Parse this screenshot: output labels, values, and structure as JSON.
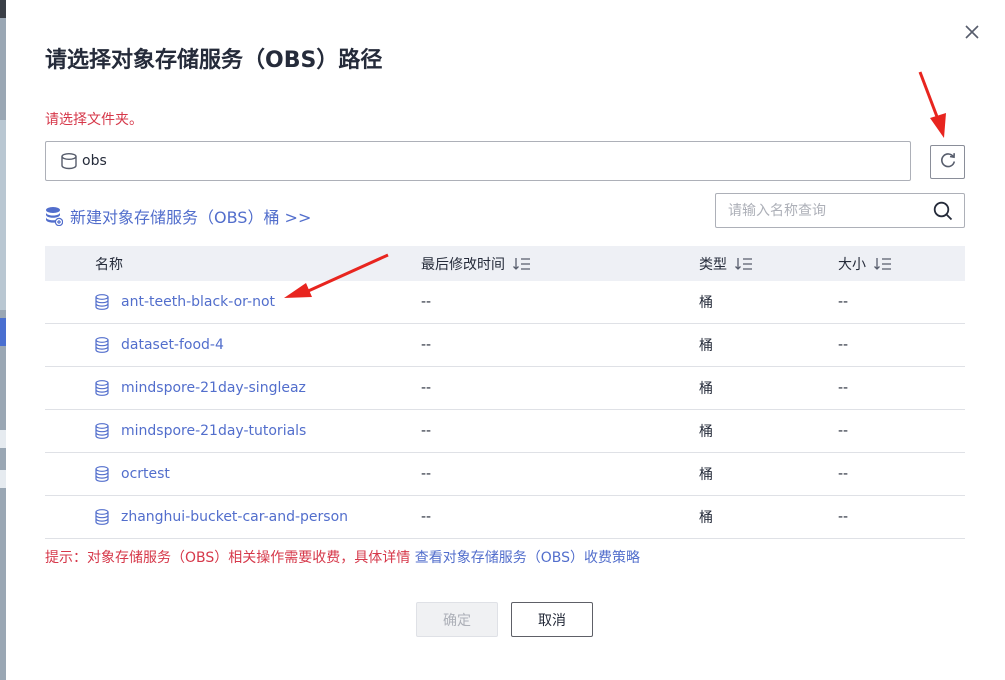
{
  "dialog": {
    "title": "请选择对象存储服务（OBS）路径",
    "folder_hint": "请选择文件夹。",
    "path_value": "obs",
    "create_bucket_link": "新建对象存储服务（OBS）桶 >>",
    "search_placeholder": "请输入名称查询"
  },
  "table": {
    "columns": [
      "名称",
      "最后修改时间",
      "类型",
      "大小"
    ],
    "rows": [
      {
        "name": "ant-teeth-black-or-not",
        "modified": "--",
        "type": "桶",
        "size": "--"
      },
      {
        "name": "dataset-food-4",
        "modified": "--",
        "type": "桶",
        "size": "--"
      },
      {
        "name": "mindspore-21day-singleaz",
        "modified": "--",
        "type": "桶",
        "size": "--"
      },
      {
        "name": "mindspore-21day-tutorials",
        "modified": "--",
        "type": "桶",
        "size": "--"
      },
      {
        "name": "ocrtest",
        "modified": "--",
        "type": "桶",
        "size": "--"
      },
      {
        "name": "zhanghui-bucket-car-and-person",
        "modified": "--",
        "type": "桶",
        "size": "--"
      }
    ]
  },
  "fee_tip": {
    "text": "提示：对象存储服务（OBS）相关操作需要收费，具体详情",
    "link": "查看对象存储服务（OBS）收费策略"
  },
  "buttons": {
    "confirm": "确定",
    "cancel": "取消"
  },
  "colors": {
    "link": "#526ecc",
    "warning": "#d6384a",
    "header_bg": "#eef0f5",
    "arrow": "#e8251f"
  },
  "icons": [
    "close-icon",
    "bucket-icon",
    "refresh-icon",
    "create-bucket-icon",
    "search-icon",
    "sort-icon"
  ]
}
